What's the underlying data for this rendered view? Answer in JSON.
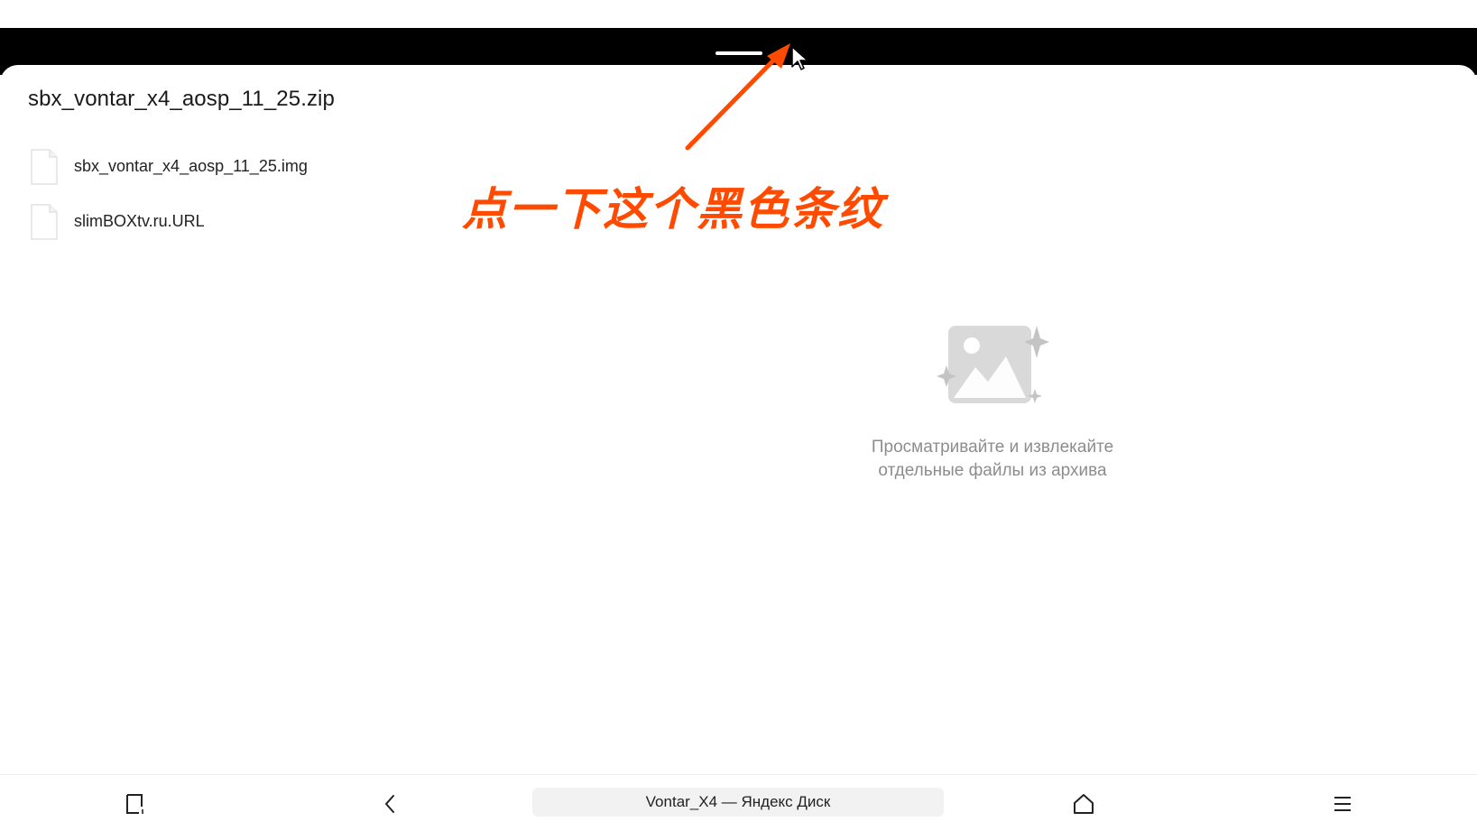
{
  "archive": {
    "title": "sbx_vontar_x4_aosp_11_25.zip",
    "files": [
      {
        "name": "sbx_vontar_x4_aosp_11_25.img",
        "icon": "file-icon"
      },
      {
        "name": "slimBOXtv.ru.URL",
        "icon": "file-icon"
      }
    ]
  },
  "empty_state": {
    "icon": "image-sparkle-icon",
    "line1": "Просматривайте и извлекайте",
    "line2": "отдельные файлы из архива"
  },
  "annotation": {
    "text": "点一下这个黑色条纹",
    "color": "#ff4a00"
  },
  "bottom_bar": {
    "tabs_icon": "tabs-icon",
    "back_icon": "back-chevron-icon",
    "address": "Vontar_X4 — Яндекс Диск",
    "home_icon": "home-icon",
    "menu_icon": "menu-icon"
  },
  "colors": {
    "handle_bar": "#000000",
    "accent": "#ff4a00",
    "muted_text": "#8d8d8d"
  }
}
